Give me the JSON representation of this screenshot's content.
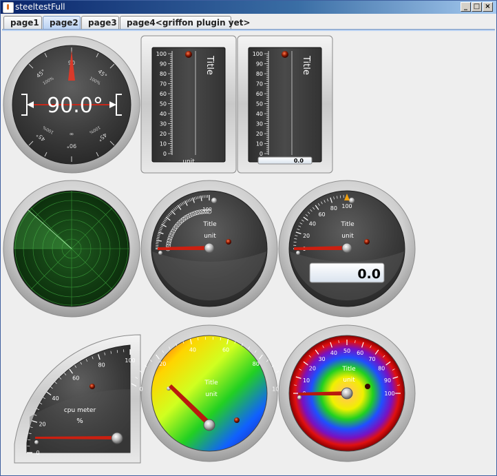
{
  "window": {
    "title": "steeltestFull",
    "buttons": {
      "minimize": "_",
      "maximize": "□",
      "close": "×"
    }
  },
  "tabs": [
    {
      "label": "page1",
      "selected": false
    },
    {
      "label": "page2",
      "selected": true
    },
    {
      "label": "page3",
      "selected": false
    },
    {
      "label": "page4<griffon plugin yet>",
      "selected": false
    }
  ],
  "compass": {
    "value": "90.0°",
    "ticks": [
      "90",
      "45°",
      "45°",
      "45°",
      "45°",
      "100%",
      "100%",
      "100%",
      "100%",
      "∞",
      "90°"
    ]
  },
  "linear1": {
    "title": "Title",
    "unit": "unit",
    "scale": [
      "100",
      "90",
      "80",
      "70",
      "60",
      "50",
      "40",
      "30",
      "20",
      "10",
      "0"
    ]
  },
  "linear2": {
    "title": "Title",
    "scale": [
      "100",
      "90",
      "80",
      "70",
      "60",
      "50",
      "40",
      "30",
      "20",
      "10",
      "0"
    ],
    "lcd": "0.0"
  },
  "radial_cloud": {
    "title": "Title",
    "unit": "unit",
    "max_label": "100"
  },
  "radial_lcd": {
    "title": "Title",
    "unit": "unit",
    "scale": [
      "0",
      "20",
      "40",
      "60",
      "80",
      "100"
    ],
    "lcd": "0.0"
  },
  "quarter": {
    "title": "cpu meter",
    "unit": "%",
    "scale": [
      "0",
      "20",
      "40",
      "60",
      "80",
      "100"
    ]
  },
  "rainbow1": {
    "title": "Title",
    "unit": "unit",
    "scale": [
      "0",
      "20",
      "40",
      "60",
      "80",
      "100"
    ]
  },
  "rainbow2": {
    "title": "Title",
    "unit": "unit",
    "scale": [
      "0",
      "10",
      "20",
      "30",
      "40",
      "50",
      "60",
      "70",
      "80",
      "90",
      "100"
    ]
  },
  "colors": {
    "accent": "#b9d1f2",
    "needle": "#cc1f10",
    "radar_green": "#1f7a1f"
  }
}
